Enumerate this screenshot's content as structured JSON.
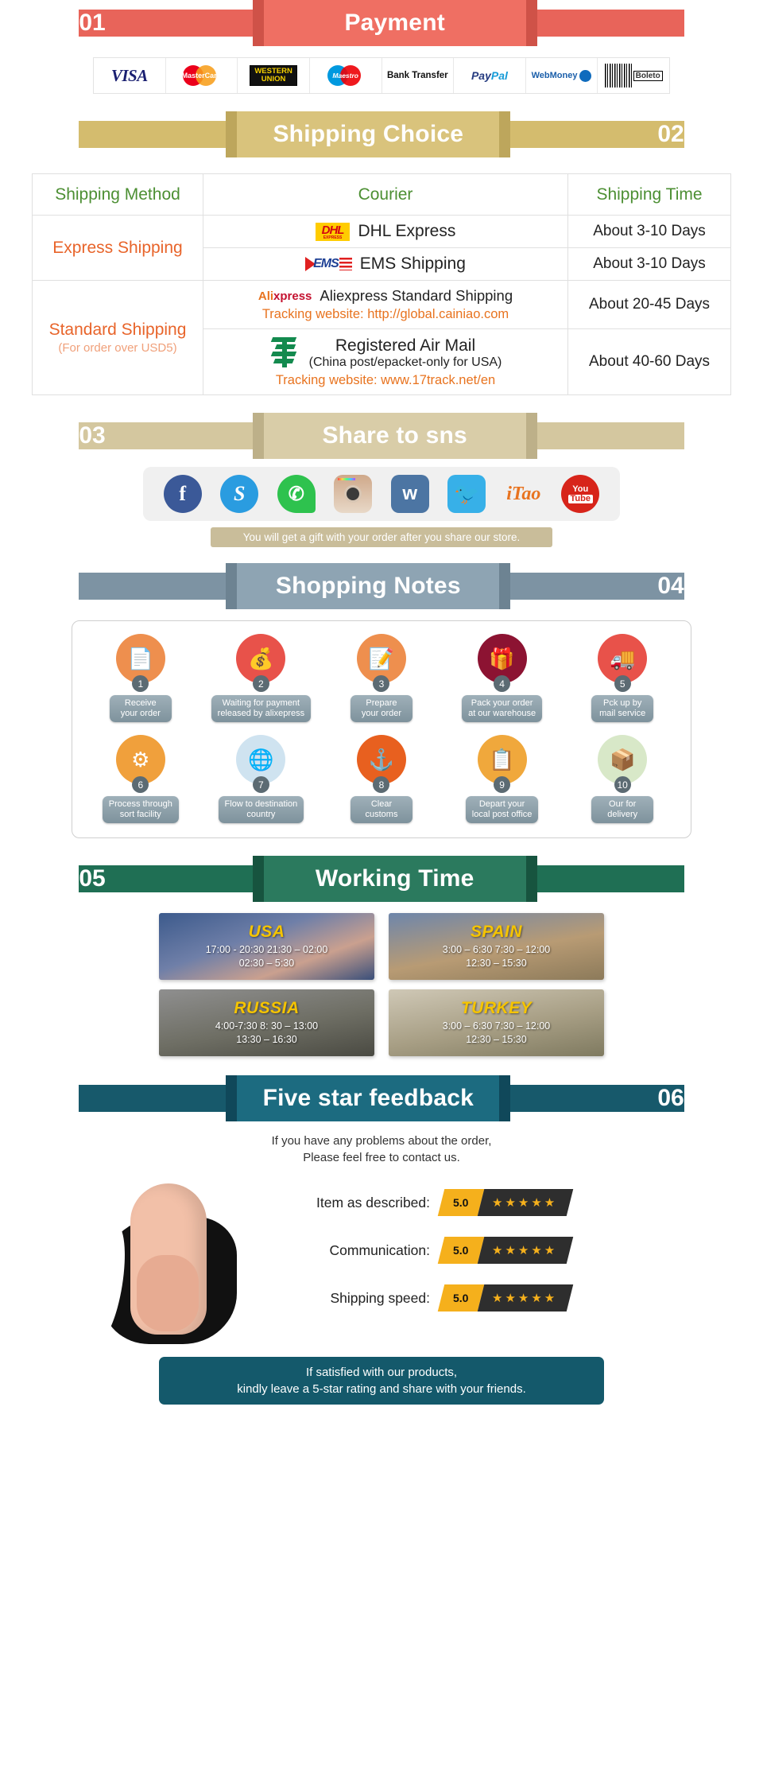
{
  "sections": {
    "payment": {
      "num": "01",
      "title": "Payment"
    },
    "shipping": {
      "num": "02",
      "title": "Shipping Choice"
    },
    "sns": {
      "num": "03",
      "title": "Share to sns"
    },
    "notes": {
      "num": "04",
      "title": "Shopping Notes"
    },
    "working": {
      "num": "05",
      "title": "Working Time"
    },
    "feedback": {
      "num": "06",
      "title": "Five star feedback"
    }
  },
  "payment_methods": [
    {
      "name": "VISA",
      "icon": "visa-logo"
    },
    {
      "name": "MasterCard",
      "icon": "mastercard-logo"
    },
    {
      "name": "WESTERN UNION",
      "line1": "WESTERN",
      "line2": "UNION",
      "icon": "western-union-logo"
    },
    {
      "name": "Maestro",
      "icon": "maestro-logo"
    },
    {
      "name": "Bank Transfer",
      "icon": "bank-transfer-logo"
    },
    {
      "name": "PayPal",
      "p1": "Pay",
      "p2": "Pal",
      "icon": "paypal-logo"
    },
    {
      "name": "WebMoney",
      "icon": "webmoney-logo"
    },
    {
      "name": "Boleto",
      "icon": "boleto-logo"
    }
  ],
  "shipping_table": {
    "headers": [
      "Shipping Method",
      "Courier",
      "Shipping Time"
    ],
    "rows": [
      {
        "method": "Express Shipping",
        "method_sub": "",
        "couriers": [
          {
            "logo": "dhl-logo",
            "logo_text": "DHL",
            "logo_sub": "EXPRESS",
            "name": "DHL Express",
            "name_sub": "",
            "tracking": "",
            "time": "About 3-10 Days"
          },
          {
            "logo": "ems-logo",
            "logo_text": "EMS",
            "logo_sub": "",
            "name": "EMS Shipping",
            "name_sub": "",
            "tracking": "",
            "time": "About 3-10 Days"
          }
        ]
      },
      {
        "method": "Standard Shipping",
        "method_sub": "(For order over USD5)",
        "couriers": [
          {
            "logo": "aliexpress-logo",
            "logo_text": "Ali",
            "logo_text2": "xpress",
            "name": "Aliexpress Standard Shipping",
            "name_sub": "",
            "tracking": "Tracking website: http://global.cainiao.com",
            "time": "About 20-45 Days"
          },
          {
            "logo": "china-post-logo",
            "logo_text": "",
            "name": "Registered Air Mail",
            "name_sub": "(China post/epacket-only for USA)",
            "tracking": "Tracking website: www.17track.net/en",
            "time": "About 40-60 Days"
          }
        ]
      }
    ]
  },
  "sns_icons": [
    {
      "name": "facebook-icon",
      "glyph": "f"
    },
    {
      "name": "skype-icon",
      "glyph": "S"
    },
    {
      "name": "whatsapp-icon",
      "glyph": "✆"
    },
    {
      "name": "instagram-icon",
      "glyph": ""
    },
    {
      "name": "vk-icon",
      "glyph": "w"
    },
    {
      "name": "twitter-icon",
      "glyph": "🐦"
    },
    {
      "name": "itao-icon",
      "glyph": "iTao"
    },
    {
      "name": "youtube-icon",
      "glyph": "You",
      "glyph2": "Tube"
    }
  ],
  "sns_note": "You will get a gift with your order after you share our store.",
  "notes_steps": [
    {
      "num": "1",
      "label": "Receive\nyour order",
      "icon": "document-icon",
      "glyph": "📄",
      "color": "#ee8f4e"
    },
    {
      "num": "2",
      "label": "Waiting for payment\nreleased by alixepress",
      "icon": "money-bag-icon",
      "glyph": "💰",
      "color": "#e8524a"
    },
    {
      "num": "3",
      "label": "Prepare\nyour order",
      "icon": "document-pen-icon",
      "glyph": "📝",
      "color": "#ee8f4e"
    },
    {
      "num": "4",
      "label": "Pack your order\nat our warehouse",
      "icon": "gift-box-icon",
      "glyph": "🎁",
      "color": "#8c1332"
    },
    {
      "num": "5",
      "label": "Pck up by\nmail service",
      "icon": "mail-truck-icon",
      "glyph": "🚚",
      "color": "#e8524a"
    },
    {
      "num": "6",
      "label": "Process through\nsort facility",
      "icon": "sorting-icon",
      "glyph": "⚙",
      "color": "#f0a03c"
    },
    {
      "num": "7",
      "label": "Flow to destination\ncountry",
      "icon": "globe-icon",
      "glyph": "🌐",
      "color": "#cfe3f0"
    },
    {
      "num": "8",
      "label": "Clear\ncustoms",
      "icon": "anchor-icon",
      "glyph": "⚓",
      "color": "#e8601f"
    },
    {
      "num": "9",
      "label": "Depart your\nlocal post office",
      "icon": "clipboard-icon",
      "glyph": "📋",
      "color": "#f0a83c"
    },
    {
      "num": "10",
      "label": "Our for\ndelivery",
      "icon": "package-icon",
      "glyph": "📦",
      "color": "#d8e8c8"
    }
  ],
  "working_time": [
    {
      "country": "USA",
      "line1": "17:00 - 20:30  21:30 – 02:00",
      "line2": "02:30 – 5:30",
      "theme": "wt-usa"
    },
    {
      "country": "SPAIN",
      "line1": "3:00 – 6:30  7:30 – 12:00",
      "line2": "12:30 – 15:30",
      "theme": "wt-spain"
    },
    {
      "country": "RUSSIA",
      "line1": "4:00-7:30  8: 30 – 13:00",
      "line2": "13:30 – 16:30",
      "theme": "wt-russia"
    },
    {
      "country": "TURKEY",
      "line1": "3:00 – 6:30  7:30 – 12:00",
      "line2": "12:30 – 15:30",
      "theme": "wt-turkey"
    }
  ],
  "feedback": {
    "intro_line1": "If you have any problems about the order,",
    "intro_line2": "Please feel free to contact us.",
    "ratings": [
      {
        "label": "Item as described:",
        "score": "5.0",
        "stars": "★★★★★"
      },
      {
        "label": "Communication:",
        "score": "5.0",
        "stars": "★★★★★"
      },
      {
        "label": "Shipping speed:",
        "score": "5.0",
        "stars": "★★★★★"
      }
    ],
    "footer_line1": "If satisfied with our products,",
    "footer_line2": "kindly leave a 5-star rating and share with your friends."
  },
  "colors": {
    "payment_red": "#ef6f63",
    "shipping_gold": "#d9c37c",
    "sns_tan": "#d9cda8",
    "notes_slate": "#8ea4b3",
    "working_green": "#2b7a5e",
    "feedback_teal": "#1c6b80",
    "accent_orange": "#e8642a",
    "header_green": "#4c8f33",
    "star_gold": "#f5b01c"
  }
}
